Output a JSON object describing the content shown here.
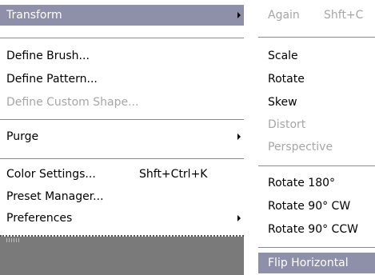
{
  "left_menu": {
    "items": [
      {
        "label": "Transform",
        "highlighted": true,
        "submenu": true
      },
      {
        "label": "Define Brush..."
      },
      {
        "label": "Define Pattern..."
      },
      {
        "label": "Define Custom Shape...",
        "disabled": true
      },
      {
        "label": "Purge",
        "submenu": true
      },
      {
        "label": "Color Settings...",
        "shortcut": "Shft+Ctrl+K"
      },
      {
        "label": "Preset Manager..."
      },
      {
        "label": "Preferences",
        "submenu": true
      }
    ]
  },
  "right_menu": {
    "items": [
      {
        "label": "Again",
        "shortcut": "Shft+C",
        "disabled": true
      },
      {
        "label": "Scale"
      },
      {
        "label": "Rotate"
      },
      {
        "label": "Skew"
      },
      {
        "label": "Distort",
        "disabled": true
      },
      {
        "label": "Perspective",
        "disabled": true
      },
      {
        "label": "Rotate 180°"
      },
      {
        "label": "Rotate 90° CW"
      },
      {
        "label": "Rotate 90° CCW"
      },
      {
        "label": "Flip Horizontal",
        "highlighted": true
      }
    ]
  },
  "colors": {
    "highlight": "#8e8fa8",
    "disabled_text": "#a6a6a6",
    "separator": "#8a8a8a",
    "panel_gray": "#7a7a7a"
  }
}
